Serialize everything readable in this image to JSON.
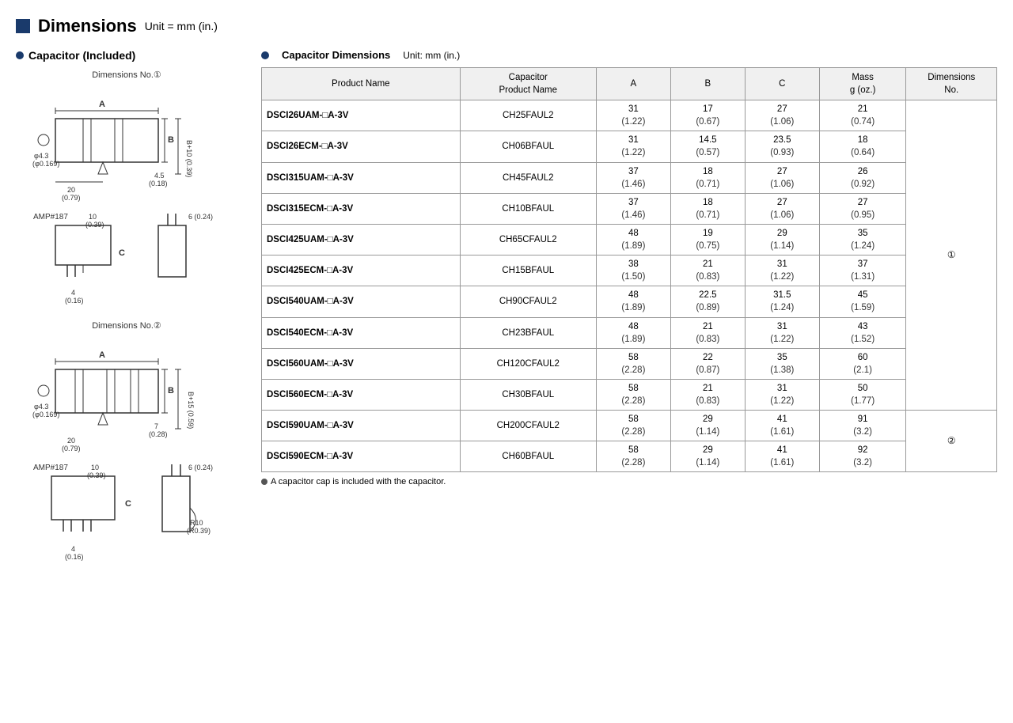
{
  "page": {
    "title": "Dimensions",
    "title_unit": "Unit = mm (in.)",
    "left_section_title": "Capacitor (Included)",
    "right_section_title": "Capacitor Dimensions",
    "right_section_unit": "Unit: mm (in.)",
    "footnote": "A capacitor cap is included with the capacitor.",
    "dim_no_1": "Dimensions No.①",
    "dim_no_2": "Dimensions No.②"
  },
  "table": {
    "headers": {
      "product_name": "Product Name",
      "cap_product_name": "Capacitor\nProduct Name",
      "a": "A",
      "b": "B",
      "c": "C",
      "mass": "Mass\ng (oz.)",
      "dimensions_no": "Dimensions\nNo."
    },
    "rows": [
      {
        "product": "DSCI26UAM-□A-3V",
        "cap_product": "CH25FAUL2",
        "a": "31",
        "a_sub": "(1.22)",
        "b": "17",
        "b_sub": "(0.67)",
        "c": "27",
        "c_sub": "(1.06)",
        "mass": "21",
        "mass_sub": "(0.74)",
        "dim_no": "①",
        "rowspan": 10
      },
      {
        "product": "DSCI26ECM-□A-3V",
        "cap_product": "CH06BFAUL",
        "a": "31",
        "a_sub": "(1.22)",
        "b": "14.5",
        "b_sub": "(0.57)",
        "c": "23.5",
        "c_sub": "(0.93)",
        "mass": "18",
        "mass_sub": "(0.64)",
        "dim_no": null
      },
      {
        "product": "DSCI315UAM-□A-3V",
        "cap_product": "CH45FAUL2",
        "a": "37",
        "a_sub": "(1.46)",
        "b": "18",
        "b_sub": "(0.71)",
        "c": "27",
        "c_sub": "(1.06)",
        "mass": "26",
        "mass_sub": "(0.92)",
        "dim_no": null
      },
      {
        "product": "DSCI315ECM-□A-3V",
        "cap_product": "CH10BFAUL",
        "a": "37",
        "a_sub": "(1.46)",
        "b": "18",
        "b_sub": "(0.71)",
        "c": "27",
        "c_sub": "(1.06)",
        "mass": "27",
        "mass_sub": "(0.95)",
        "dim_no": null
      },
      {
        "product": "DSCI425UAM-□A-3V",
        "cap_product": "CH65CFAUL2",
        "a": "48",
        "a_sub": "(1.89)",
        "b": "19",
        "b_sub": "(0.75)",
        "c": "29",
        "c_sub": "(1.14)",
        "mass": "35",
        "mass_sub": "(1.24)",
        "dim_no": null
      },
      {
        "product": "DSCI425ECM-□A-3V",
        "cap_product": "CH15BFAUL",
        "a": "38",
        "a_sub": "(1.50)",
        "b": "21",
        "b_sub": "(0.83)",
        "c": "31",
        "c_sub": "(1.22)",
        "mass": "37",
        "mass_sub": "(1.31)",
        "dim_no": null
      },
      {
        "product": "DSCI540UAM-□A-3V",
        "cap_product": "CH90CFAUL2",
        "a": "48",
        "a_sub": "(1.89)",
        "b": "22.5",
        "b_sub": "(0.89)",
        "c": "31.5",
        "c_sub": "(1.24)",
        "mass": "45",
        "mass_sub": "(1.59)",
        "dim_no": null
      },
      {
        "product": "DSCI540ECM-□A-3V",
        "cap_product": "CH23BFAUL",
        "a": "48",
        "a_sub": "(1.89)",
        "b": "21",
        "b_sub": "(0.83)",
        "c": "31",
        "c_sub": "(1.22)",
        "mass": "43",
        "mass_sub": "(1.52)",
        "dim_no": null
      },
      {
        "product": "DSCI560UAM-□A-3V",
        "cap_product": "CH120CFAUL2",
        "a": "58",
        "a_sub": "(2.28)",
        "b": "22",
        "b_sub": "(0.87)",
        "c": "35",
        "c_sub": "(1.38)",
        "mass": "60",
        "mass_sub": "(2.1)",
        "dim_no": null
      },
      {
        "product": "DSCI560ECM-□A-3V",
        "cap_product": "CH30BFAUL",
        "a": "58",
        "a_sub": "(2.28)",
        "b": "21",
        "b_sub": "(0.83)",
        "c": "31",
        "c_sub": "(1.22)",
        "mass": "50",
        "mass_sub": "(1.77)",
        "dim_no": null
      },
      {
        "product": "DSCI590UAM-□A-3V",
        "cap_product": "CH200CFAUL2",
        "a": "58",
        "a_sub": "(2.28)",
        "b": "29",
        "b_sub": "(1.14)",
        "c": "41",
        "c_sub": "(1.61)",
        "mass": "91",
        "mass_sub": "(3.2)",
        "dim_no": "②",
        "rowspan": 2
      },
      {
        "product": "DSCI590ECM-□A-3V",
        "cap_product": "CH60BFAUL",
        "a": "58",
        "a_sub": "(2.28)",
        "b": "29",
        "b_sub": "(1.14)",
        "c": "41",
        "c_sub": "(1.61)",
        "mass": "92",
        "mass_sub": "(3.2)",
        "dim_no": null
      }
    ]
  }
}
